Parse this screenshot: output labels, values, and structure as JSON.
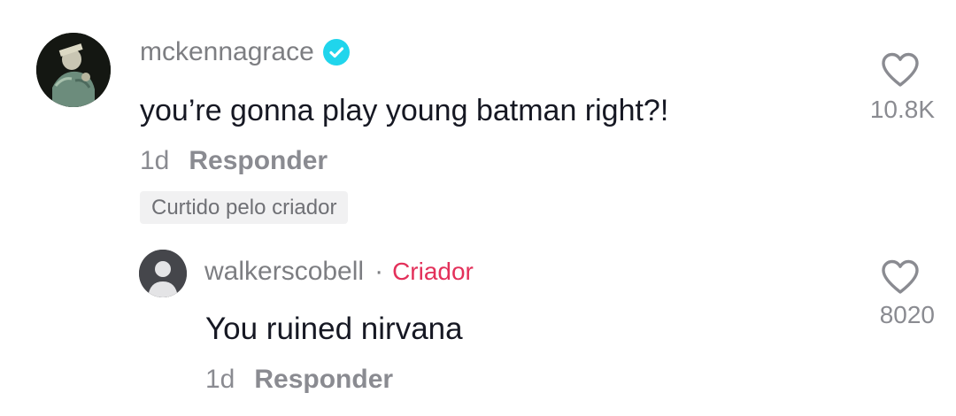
{
  "comment": {
    "username": "mckennagrace",
    "verified_icon": "verified-checkmark-icon",
    "text": "you’re gonna play young batman right?!",
    "time": "1d",
    "reply_label": "Responder",
    "badge": "Curtido pelo criador",
    "like_icon": "heart-outline-icon",
    "like_count": "10.8K"
  },
  "reply": {
    "username": "walkerscobell",
    "separator": "·",
    "role_label": "Criador",
    "text": "You ruined nirvana",
    "time": "1d",
    "reply_label": "Responder",
    "like_icon": "heart-outline-icon",
    "like_count": "8020"
  },
  "colors": {
    "verified": "#20d5ec",
    "creator": "#e3305a",
    "muted": "#8a8b91",
    "text": "#161823"
  }
}
